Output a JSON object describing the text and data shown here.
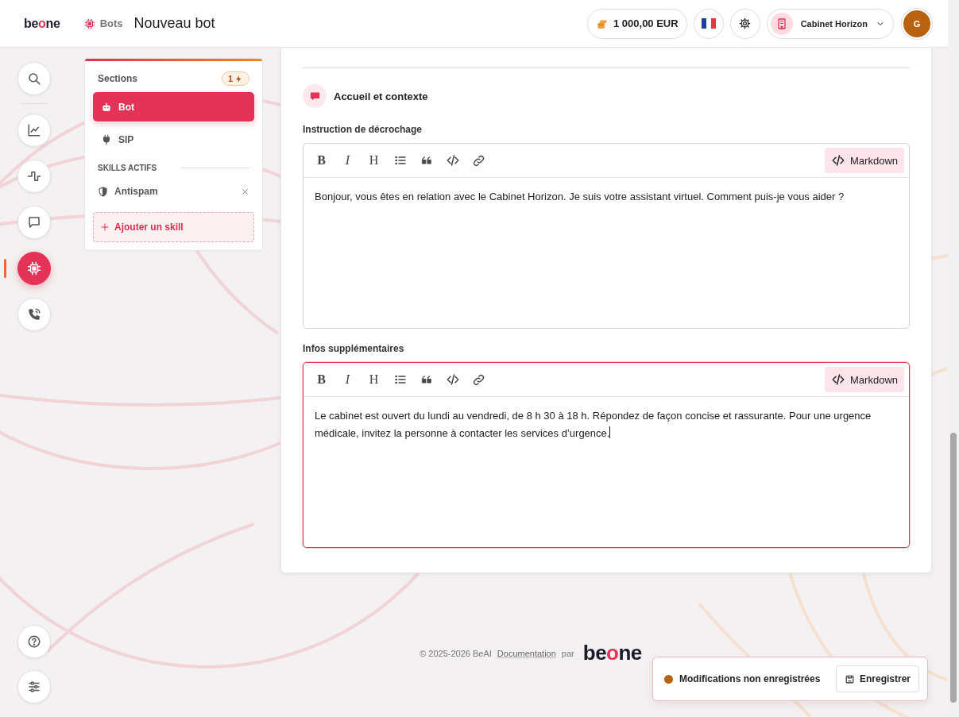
{
  "header": {
    "logo": "beone",
    "breadcrumb": "Bots",
    "title": "Nouveau bot",
    "balance": "1 000,00 EUR",
    "organization": "Cabinet Horizon",
    "avatar": "G"
  },
  "rail": {
    "items": [
      {
        "kind": "search",
        "selected": false
      },
      {
        "kind": "chart",
        "selected": false
      },
      {
        "kind": "pulse",
        "selected": false
      },
      {
        "kind": "chat",
        "selected": false
      },
      {
        "kind": "chip",
        "selected": true
      },
      {
        "kind": "phone",
        "selected": false
      }
    ],
    "bottom": [
      {
        "kind": "help"
      },
      {
        "kind": "sliders"
      }
    ]
  },
  "sections": {
    "title": "Sections",
    "badge": "1",
    "items": [
      {
        "kind": "robot",
        "label": "Bot",
        "selected": true
      },
      {
        "kind": "plug",
        "label": "SIP",
        "selected": false
      }
    ],
    "skills_title": "SKILLS ACTIFS",
    "skills": [
      {
        "kind": "shield",
        "label": "Antispam"
      }
    ],
    "add_skill": "Ajouter un skill"
  },
  "section": {
    "title": "Accueil et contexte",
    "fields": [
      {
        "label": "Instruction de décrochage",
        "mode_button": "Markdown",
        "focused": false,
        "value": "Bonjour, vous êtes en relation avec le Cabinet Horizon. Je suis votre assistant virtuel. Comment puis-je vous aider ?",
        "toolbar": [
          {
            "kind": "bold",
            "label": "B"
          },
          {
            "kind": "italic",
            "label": "I"
          },
          {
            "kind": "heading",
            "label": "H"
          },
          {
            "kind": "list"
          },
          {
            "kind": "quote"
          },
          {
            "kind": "code"
          },
          {
            "kind": "link"
          }
        ]
      },
      {
        "label": "Infos supplémentaires",
        "mode_button": "Markdown",
        "focused": true,
        "value": "Le cabinet est ouvert du lundi au vendredi, de 8 h 30 à 18 h. Répondez de façon concise et rassurante. Pour une urgence médicale, invitez la personne à contacter les services d’urgence.",
        "toolbar": [
          {
            "kind": "bold",
            "label": "B"
          },
          {
            "kind": "italic",
            "label": "I"
          },
          {
            "kind": "heading",
            "label": "H"
          },
          {
            "kind": "list"
          },
          {
            "kind": "quote"
          },
          {
            "kind": "code"
          },
          {
            "kind": "link"
          }
        ]
      }
    ]
  },
  "footer": {
    "copyright": "© 2025-2026 BeAI",
    "link": "Documentation",
    "by": "par",
    "logo": "beone"
  },
  "toast": {
    "message": "Modifications non enregistrées",
    "button": "Enregistrer"
  }
}
